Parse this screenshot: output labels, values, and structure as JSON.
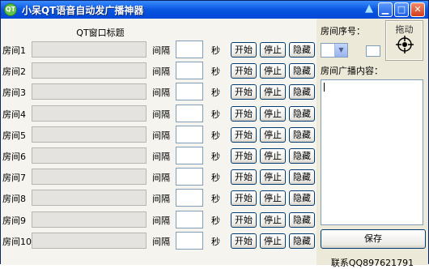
{
  "window": {
    "title": "小呆QT语音自动发广播神器",
    "app_icon_text": "QT",
    "minimize_glyph": "▁",
    "maximize_glyph": "□",
    "close_glyph": "✕"
  },
  "main": {
    "header_caption": "QT窗口标题",
    "interval_label": "间隔",
    "seconds_label": "秒",
    "start_label": "开始",
    "stop_label": "停止",
    "hide_label": "隐藏",
    "rooms": [
      {
        "label": "房间1",
        "title": "",
        "interval": ""
      },
      {
        "label": "房间2",
        "title": "",
        "interval": ""
      },
      {
        "label": "房间3",
        "title": "",
        "interval": ""
      },
      {
        "label": "房间4",
        "title": "",
        "interval": ""
      },
      {
        "label": "房间5",
        "title": "",
        "interval": ""
      },
      {
        "label": "房间6",
        "title": "",
        "interval": ""
      },
      {
        "label": "房间7",
        "title": "",
        "interval": ""
      },
      {
        "label": "房间8",
        "title": "",
        "interval": ""
      },
      {
        "label": "房间9",
        "title": "",
        "interval": ""
      },
      {
        "label": "房间10",
        "title": "",
        "interval": ""
      }
    ]
  },
  "right": {
    "room_number_label": "房间序号：",
    "room_number_value": "",
    "drag_label": "拖动",
    "content_label": "房间广播内容：",
    "content_value": "",
    "save_label": "保存",
    "contact": "联系QQ897621791"
  },
  "icons": {
    "app": "qt-app-icon",
    "skin": "shirt-icon",
    "drag": "crosshair-target-icon"
  },
  "colors": {
    "titlebar": "#0a56e0",
    "window_bg": "#ece9d8",
    "main_bg": "#f5f4ef",
    "button_border": "#003c74"
  }
}
